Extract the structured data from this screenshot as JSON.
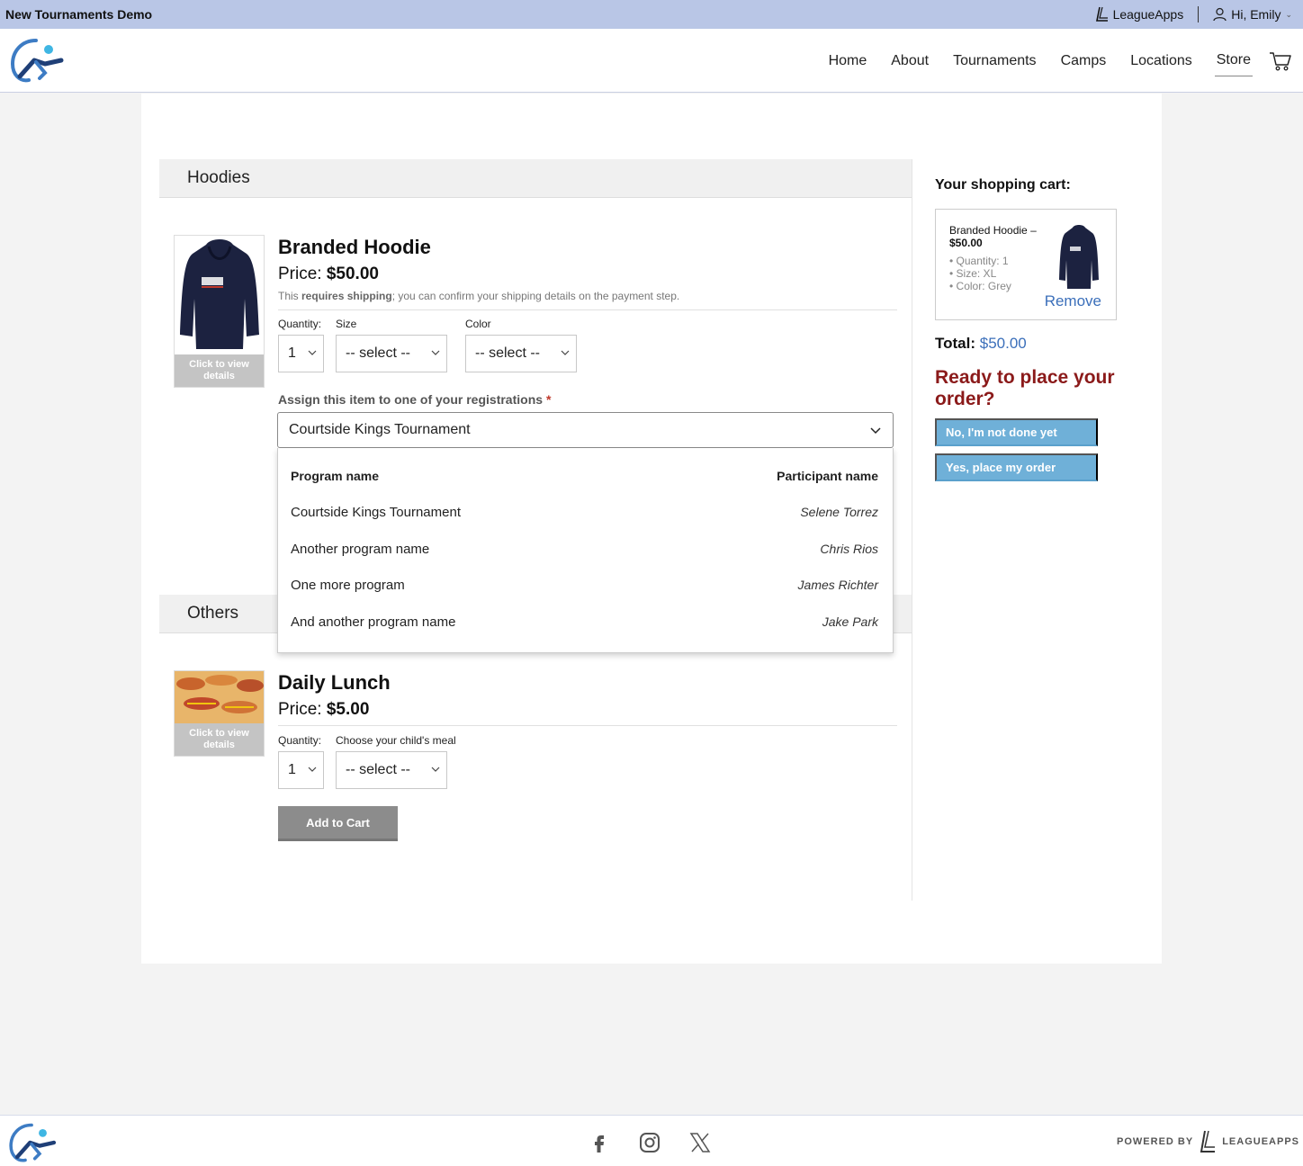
{
  "topbar": {
    "org_name": "New Tournaments Demo",
    "leagueapps_link": "LeagueApps",
    "user_greeting": "Hi, Emily"
  },
  "nav": {
    "items": [
      {
        "label": "Home"
      },
      {
        "label": "About"
      },
      {
        "label": "Tournaments"
      },
      {
        "label": "Camps"
      },
      {
        "label": "Locations"
      },
      {
        "label": "Store"
      }
    ],
    "active": "Store"
  },
  "sections": {
    "hoodies": {
      "title": "Hoodies",
      "product": {
        "name": "Branded Hoodie",
        "price_label": "Price:",
        "price": "$50.00",
        "shipping_prefix": "This ",
        "shipping_bold": "requires shipping",
        "shipping_suffix": "; you can confirm your shipping details on the payment step.",
        "thumb_label": "Click to view details",
        "quantity_label": "Quantity:",
        "quantity_value": "1",
        "size_label": "Size",
        "size_value": "-- select --",
        "color_label": "Color",
        "color_value": "-- select --",
        "assign_label": "Assign this item to one of your registrations",
        "assign_required": "*",
        "assign_value": "Courtside Kings Tournament"
      },
      "dropdown": {
        "header_program": "Program name",
        "header_participant": "Participant name",
        "rows": [
          {
            "program": "Courtside Kings Tournament",
            "participant": "Selene Torrez"
          },
          {
            "program": "Another program name",
            "participant": "Chris Rios"
          },
          {
            "program": "One more program",
            "participant": "James Richter"
          },
          {
            "program": "And another program name",
            "participant": "Jake Park"
          }
        ]
      }
    },
    "others": {
      "title": "Others",
      "product": {
        "name": "Daily Lunch",
        "price_label": "Price:",
        "price": "$5.00",
        "thumb_label": "Click to view details",
        "quantity_label": "Quantity:",
        "quantity_value": "1",
        "meal_label": "Choose your child's meal",
        "meal_value": "-- select --",
        "add_button": "Add to Cart"
      }
    }
  },
  "cart": {
    "title": "Your shopping cart:",
    "item_name": "Branded Hoodie –",
    "item_price": "$50.00",
    "details": [
      "Quantity: 1",
      "Size: XL",
      "Color: Grey"
    ],
    "remove_label": "Remove",
    "total_label": "Total:",
    "total_value": "$50.00",
    "ready_text": "Ready to place your order?",
    "not_done_button": "No, I'm not done yet",
    "place_order_button": "Yes, place my order"
  },
  "footer": {
    "powered_by": "POWERED BY",
    "brand": "LEAGUEAPPS"
  },
  "colors": {
    "topbar_bg": "#b9c6e6",
    "accent_blue": "#3b6fba",
    "ready_red": "#8b1a1a",
    "button_blue": "#6fb0d8",
    "button_gray": "#8c8c8c"
  }
}
